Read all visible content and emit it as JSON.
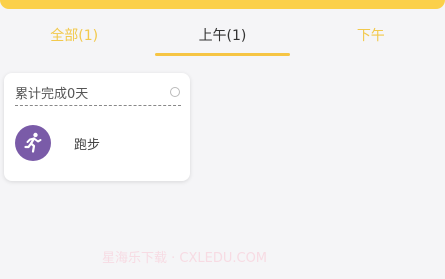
{
  "tabs": [
    {
      "label": "全部(1)",
      "active": false
    },
    {
      "label": "上午(1)",
      "active": true
    },
    {
      "label": "下午",
      "active": false
    }
  ],
  "card": {
    "title": "累计完成0天",
    "tasks": [
      {
        "label": "跑步",
        "icon": "running-person-icon",
        "icon_color": "#7a5ba8"
      }
    ]
  },
  "watermark": "星海乐下载 · CXLEDU.COM",
  "colors": {
    "accent": "#fbd04a",
    "tab_inactive": "#f2c94c",
    "tab_active": "#333333",
    "background": "#f5f5f7"
  }
}
